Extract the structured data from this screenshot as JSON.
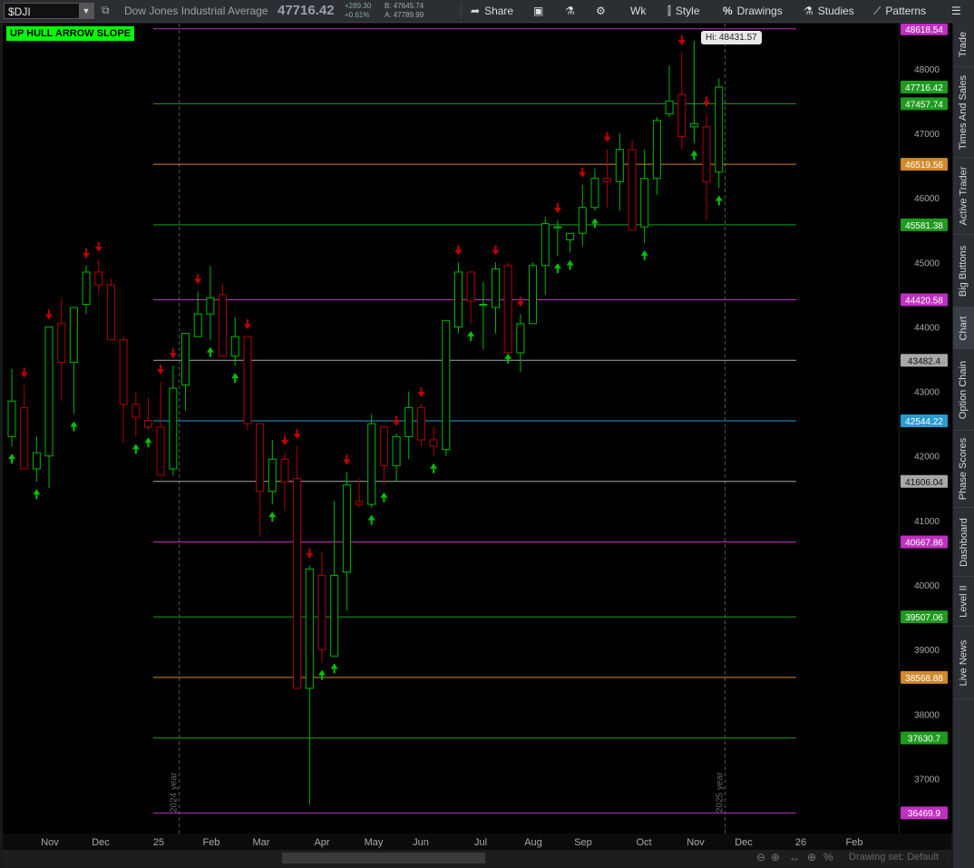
{
  "toolbar": {
    "symbol": "$DJI",
    "description": "Dow Jones Industrial Average",
    "last": "47716.42",
    "change": "+289.30",
    "change_pct": "+0.61%",
    "bid": "B: 47645.74",
    "ask": "A: 47789.99",
    "share": "Share",
    "timeframe": "Wk",
    "style": "Style",
    "drawings": "Drawings",
    "studies": "Studies",
    "patterns": "Patterns"
  },
  "study_label": "UP HULL ARROW SLOPE",
  "hi_label": "Hi: 48431.57",
  "year_labels": [
    "2024 year",
    "2025 year"
  ],
  "sidebar_tabs": [
    "Trade",
    "Times And Sales",
    "Active Trader",
    "Big Buttons",
    "Chart",
    "Option Chain",
    "Phase Scores",
    "Dashboard",
    "Level II",
    "Live News"
  ],
  "active_tab": "Chart",
  "drawing_set": "Drawing set: Default",
  "colors": {
    "up": "#00b800",
    "down": "#b00000",
    "green_level": "#1f9a1f",
    "magenta_level": "#c030c0",
    "orange_level": "#d08a2a",
    "gray_level": "#a8a8a8",
    "blue_level": "#2a9ad0",
    "hull_label_bg": "#00ff00"
  },
  "chart_data": {
    "type": "candlestick",
    "symbol": "$DJI",
    "period": "weekly",
    "ylim": [
      36150,
      48700
    ],
    "y_ticks": [
      37000,
      38000,
      39000,
      40000,
      41000,
      42000,
      43000,
      44000,
      45000,
      46000,
      47000,
      48000
    ],
    "x_labels": [
      "Nov",
      "Dec",
      "25",
      "Feb",
      "Mar",
      "Apr",
      "May",
      "Jun",
      "Jul",
      "Aug",
      "Sep",
      "Oct",
      "Nov",
      "Dec",
      "26",
      "Feb"
    ],
    "levels": [
      {
        "value": 48618.54,
        "color": "magenta"
      },
      {
        "value": 47457.74,
        "color": "green"
      },
      {
        "value": 46519.56,
        "color": "orange"
      },
      {
        "value": 45581.38,
        "color": "green"
      },
      {
        "value": 44420.58,
        "color": "magenta"
      },
      {
        "value": 43482.4,
        "color": "gray"
      },
      {
        "value": 42544.22,
        "color": "blue"
      },
      {
        "value": 41606.04,
        "color": "gray"
      },
      {
        "value": 40667.86,
        "color": "magenta"
      },
      {
        "value": 39507.06,
        "color": "green"
      },
      {
        "value": 38568.88,
        "color": "orange"
      },
      {
        "value": 37630.7,
        "color": "green"
      },
      {
        "value": 36469.9,
        "color": "magenta"
      }
    ],
    "current_price": 47716.42,
    "high": 48431.57,
    "candles": [
      {
        "o": 42300,
        "h": 43350,
        "l": 42150,
        "c": 42850
      },
      {
        "o": 42750,
        "h": 43100,
        "l": 41950,
        "c": 41800
      },
      {
        "o": 41800,
        "h": 42300,
        "l": 41600,
        "c": 42050
      },
      {
        "o": 42000,
        "h": 44000,
        "l": 41500,
        "c": 44000
      },
      {
        "o": 44050,
        "h": 44450,
        "l": 42850,
        "c": 43450
      },
      {
        "o": 43450,
        "h": 44300,
        "l": 42650,
        "c": 44300
      },
      {
        "o": 44350,
        "h": 44950,
        "l": 44200,
        "c": 44850
      },
      {
        "o": 44850,
        "h": 45050,
        "l": 44500,
        "c": 44650
      },
      {
        "o": 44650,
        "h": 44750,
        "l": 43800,
        "c": 43800
      },
      {
        "o": 43800,
        "h": 43850,
        "l": 42200,
        "c": 42800
      },
      {
        "o": 42800,
        "h": 43000,
        "l": 42300,
        "c": 42600
      },
      {
        "o": 42550,
        "h": 42900,
        "l": 42400,
        "c": 42450
      },
      {
        "o": 42450,
        "h": 43150,
        "l": 41800,
        "c": 41700
      },
      {
        "o": 41800,
        "h": 43400,
        "l": 41700,
        "c": 43050
      },
      {
        "o": 43100,
        "h": 43900,
        "l": 42700,
        "c": 43900
      },
      {
        "o": 43850,
        "h": 44550,
        "l": 43850,
        "c": 44200
      },
      {
        "o": 44200,
        "h": 44950,
        "l": 43800,
        "c": 44450
      },
      {
        "o": 44500,
        "h": 44650,
        "l": 43550,
        "c": 43550
      },
      {
        "o": 43550,
        "h": 44150,
        "l": 43400,
        "c": 43850
      },
      {
        "o": 43850,
        "h": 43850,
        "l": 42400,
        "c": 42500
      },
      {
        "o": 42500,
        "h": 42450,
        "l": 40750,
        "c": 41450
      },
      {
        "o": 41450,
        "h": 42250,
        "l": 41250,
        "c": 41950
      },
      {
        "o": 41950,
        "h": 42050,
        "l": 41150,
        "c": 41600
      },
      {
        "o": 41650,
        "h": 42150,
        "l": 40450,
        "c": 38400
      },
      {
        "o": 38400,
        "h": 40300,
        "l": 36600,
        "c": 40250
      },
      {
        "o": 40150,
        "h": 40500,
        "l": 38800,
        "c": 39000
      },
      {
        "o": 38900,
        "h": 41300,
        "l": 38900,
        "c": 40150
      },
      {
        "o": 40200,
        "h": 41750,
        "l": 39600,
        "c": 41550
      },
      {
        "o": 41300,
        "h": 41650,
        "l": 41200,
        "c": 41250
      },
      {
        "o": 41250,
        "h": 42650,
        "l": 41200,
        "c": 42500
      },
      {
        "o": 42450,
        "h": 42400,
        "l": 41550,
        "c": 41850
      },
      {
        "o": 41850,
        "h": 42350,
        "l": 41600,
        "c": 42300
      },
      {
        "o": 42300,
        "h": 43000,
        "l": 41950,
        "c": 42750
      },
      {
        "o": 42750,
        "h": 42800,
        "l": 42150,
        "c": 42250
      },
      {
        "o": 42250,
        "h": 42450,
        "l": 42000,
        "c": 42150
      },
      {
        "o": 42100,
        "h": 44100,
        "l": 42000,
        "c": 44100
      },
      {
        "o": 44000,
        "h": 45000,
        "l": 43900,
        "c": 44850
      },
      {
        "o": 44850,
        "h": 44850,
        "l": 44050,
        "c": 44400
      },
      {
        "o": 44350,
        "h": 44700,
        "l": 43650,
        "c": 44350
      },
      {
        "o": 44300,
        "h": 45000,
        "l": 43900,
        "c": 44900
      },
      {
        "o": 44950,
        "h": 45000,
        "l": 43700,
        "c": 43600
      },
      {
        "o": 43600,
        "h": 44200,
        "l": 43300,
        "c": 44050
      },
      {
        "o": 44050,
        "h": 45000,
        "l": 44050,
        "c": 44950
      },
      {
        "o": 44950,
        "h": 45700,
        "l": 44500,
        "c": 45600
      },
      {
        "o": 45550,
        "h": 45650,
        "l": 45100,
        "c": 45550
      },
      {
        "o": 45350,
        "h": 45450,
        "l": 45150,
        "c": 45450
      },
      {
        "o": 45450,
        "h": 46200,
        "l": 45250,
        "c": 45850
      },
      {
        "o": 45850,
        "h": 46450,
        "l": 45800,
        "c": 46300
      },
      {
        "o": 46300,
        "h": 46750,
        "l": 45850,
        "c": 46250
      },
      {
        "o": 46250,
        "h": 47000,
        "l": 45800,
        "c": 46750
      },
      {
        "o": 46750,
        "h": 46900,
        "l": 45550,
        "c": 45500
      },
      {
        "o": 45550,
        "h": 46750,
        "l": 45300,
        "c": 46300
      },
      {
        "o": 46300,
        "h": 47250,
        "l": 46050,
        "c": 47200
      },
      {
        "o": 47300,
        "h": 48050,
        "l": 47250,
        "c": 47500
      },
      {
        "o": 47600,
        "h": 48250,
        "l": 46750,
        "c": 46950
      },
      {
        "o": 47100,
        "h": 48431.57,
        "l": 46850,
        "c": 47150
      },
      {
        "o": 47100,
        "h": 47300,
        "l": 45650,
        "c": 46250
      },
      {
        "o": 46400,
        "h": 47850,
        "l": 46150,
        "c": 47716.42
      }
    ],
    "up_arrows": [
      0,
      2,
      5,
      10,
      11,
      16,
      18,
      21,
      25,
      26,
      29,
      30,
      34,
      37,
      40,
      44,
      45,
      47,
      51,
      55,
      57
    ],
    "down_arrows": [
      1,
      3,
      6,
      7,
      12,
      13,
      15,
      19,
      22,
      23,
      24,
      27,
      31,
      33,
      36,
      39,
      41,
      44,
      46,
      48,
      54,
      56
    ],
    "year_boundaries": [
      {
        "label": "2024 year",
        "after_candle": 13
      },
      {
        "label": "2025 year",
        "after_candle": 57
      }
    ]
  }
}
